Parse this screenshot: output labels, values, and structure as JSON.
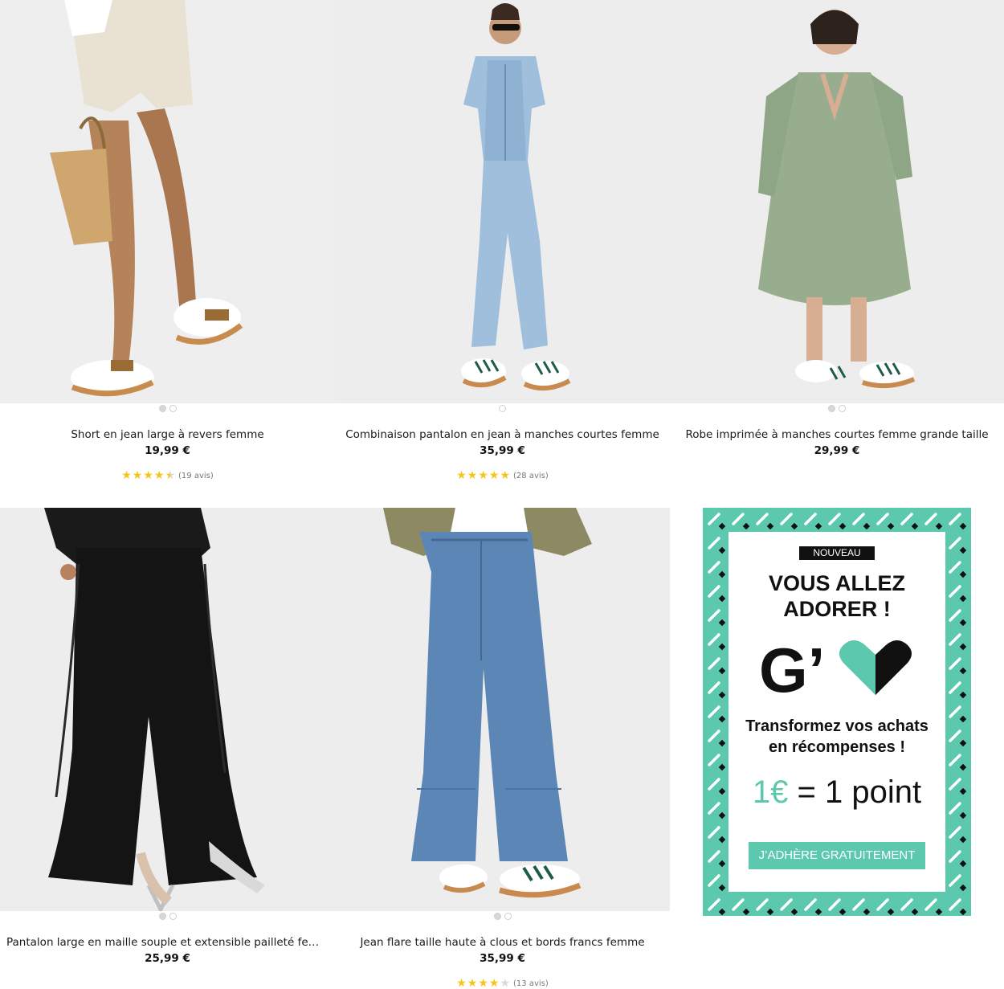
{
  "products": [
    {
      "title": "Short en jean large à revers femme",
      "price": "19,99 €",
      "rating": 4.5,
      "reviews": "(19 avis)"
    },
    {
      "title": "Combinaison pantalon en jean à manches courtes femme",
      "price": "35,99 €",
      "rating": 5,
      "reviews": "(28 avis)"
    },
    {
      "title": "Robe imprimée à manches courtes femme grande taille",
      "price": "29,99 €"
    },
    {
      "title": "Pantalon large en maille souple et extensible pailleté femme grande...",
      "price": "25,99 €"
    },
    {
      "title": "Jean flare taille haute à clous et bords francs femme",
      "price": "35,99 €",
      "rating": 4,
      "reviews": "(13 avis)"
    }
  ],
  "promo": {
    "badge": "NOUVEAU",
    "headline_line1": "VOUS ALLEZ",
    "headline_line2": "ADORER !",
    "logo_letter": "G’",
    "sub_line1": "Transformez vos achats",
    "sub_line2": "en récompenses !",
    "equation_left": "1€",
    "equation_right": " = 1 point",
    "cta": "J’ADHÈRE GRATUITEMENT"
  },
  "colors": {
    "accent": "#5cc9ae",
    "star": "#f5c518"
  }
}
